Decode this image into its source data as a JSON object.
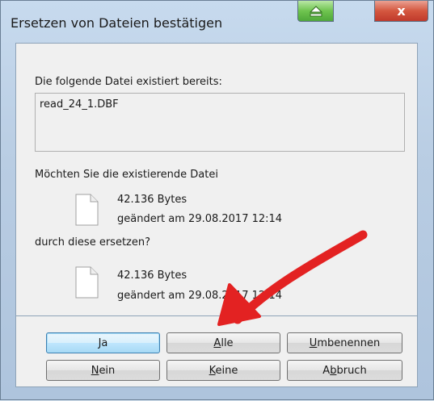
{
  "window": {
    "title": "Ersetzen von Dateien bestätigen"
  },
  "titlebar": {
    "green_button_icon": "eject-icon",
    "close_icon": "close-icon",
    "close_symbol": "x"
  },
  "message": {
    "exists_label": "Die folgende Datei existiert bereits:",
    "filename": "read_24_1.DBF",
    "question_existing": "Möchten Sie die existierende Datei",
    "question_replace": "durch diese ersetzen?"
  },
  "existing_file": {
    "size": "42.136 Bytes",
    "modified": "geändert am 29.08.2017 12:14"
  },
  "new_file": {
    "size": "42.136 Bytes",
    "modified": "geändert am 29.08.2017 12:14"
  },
  "buttons": {
    "ja": "Ja",
    "alle_mnemonic": "A",
    "alle_rest": "lle",
    "umbenennen_mnemonic": "U",
    "umbenennen_rest": "mbenennen",
    "nein_mnemonic": "N",
    "nein_rest": "ein",
    "keine_mnemonic": "K",
    "keine_rest": "eine",
    "abbruch_pre": "A",
    "abbruch_mnemonic": "b",
    "abbruch_rest": "bruch"
  },
  "annotation": {
    "arrow_color": "#e32222"
  }
}
